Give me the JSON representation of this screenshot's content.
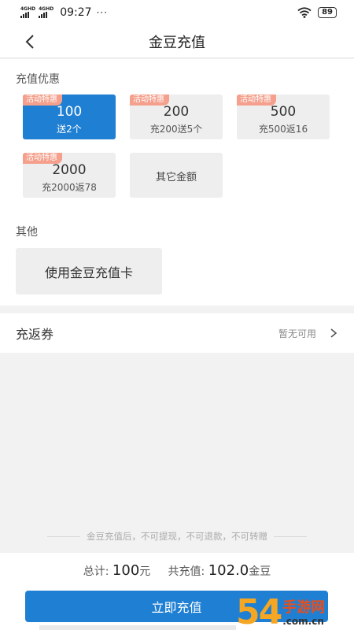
{
  "status_bar": {
    "network_1": "4GHD",
    "network_2": "4GHD",
    "time": "09:27",
    "dots": "···",
    "battery": "89"
  },
  "nav": {
    "title": "金豆充值"
  },
  "promo_section": {
    "label": "充值优惠"
  },
  "options": [
    {
      "tag": "活动特惠",
      "amount": "100",
      "bonus": "送2个",
      "selected": true
    },
    {
      "tag": "活动特惠",
      "amount": "200",
      "bonus": "充200送5个",
      "selected": false
    },
    {
      "tag": "活动特惠",
      "amount": "500",
      "bonus": "充500返16",
      "selected": false
    },
    {
      "tag": "活动特惠",
      "amount": "2000",
      "bonus": "充2000返78",
      "selected": false
    }
  ],
  "other_amount": {
    "label": "其它金额"
  },
  "other_section": {
    "label": "其他",
    "card_button": "使用金豆充值卡"
  },
  "coupon": {
    "label": "充返券",
    "status": "暂无可用"
  },
  "notice": "金豆充值后，不可提现，不可退款，不可转赠",
  "footer": {
    "total_label": "总计:",
    "total_value": "100",
    "total_unit": "元",
    "charge_label": "共充值:",
    "charge_value": "102.0",
    "charge_unit": "金豆",
    "pay_button": "立即充值"
  },
  "watermark": {
    "big": "54",
    "cn": "手游网",
    "en": ".com.cn"
  },
  "colors": {
    "accent": "#1f7fd3",
    "tag": "#f4a08c",
    "watermark_orange": "#f5a623",
    "watermark_red": "#e94e1b"
  }
}
